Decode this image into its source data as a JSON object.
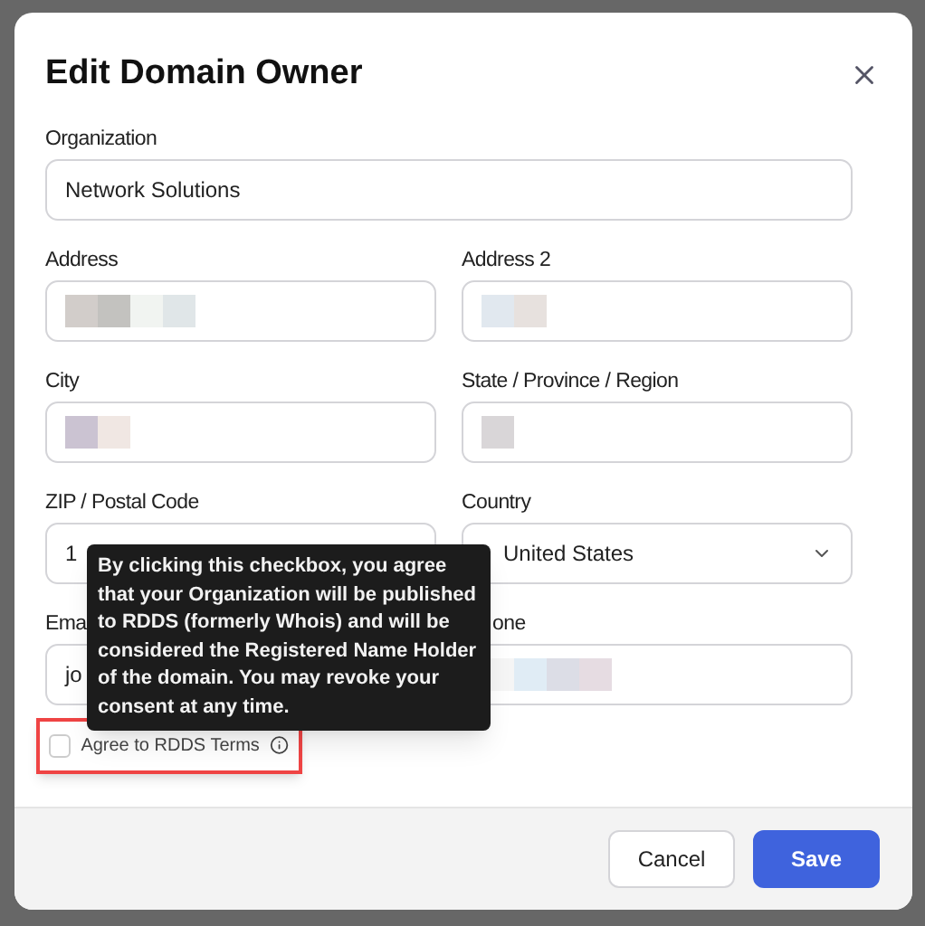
{
  "dialog": {
    "title": "Edit Domain Owner",
    "fields": [
      {
        "label": "Organization",
        "kind": "text",
        "value": "Network Solutions",
        "wide": true
      },
      {
        "label": "Address",
        "kind": "redacted"
      },
      {
        "label": "Address 2",
        "kind": "redacted"
      },
      {
        "label": "City",
        "kind": "redacted"
      },
      {
        "label": "State / Province / Region",
        "kind": "redacted"
      },
      {
        "label": "ZIP / Postal Code",
        "kind": "text",
        "value": "1"
      },
      {
        "label": "Country",
        "kind": "select",
        "value": "United States"
      },
      {
        "label": "Ema",
        "kind": "text",
        "value": "jo"
      },
      {
        "label": "one",
        "kind": "redacted",
        "label_offset": true
      }
    ],
    "checkbox": {
      "label": "Agree to RDDS Terms",
      "checked": false,
      "highlighted": true
    },
    "tooltip": "By clicking this checkbox, you agree that your Organization will be published to RDDS (formerly Whois) and will be considered the Registered Name Holder of the domain. You may revoke your consent at any time.",
    "buttons": [
      {
        "label": "Cancel",
        "kind": "secondary"
      },
      {
        "label": "Save",
        "kind": "primary"
      }
    ]
  }
}
